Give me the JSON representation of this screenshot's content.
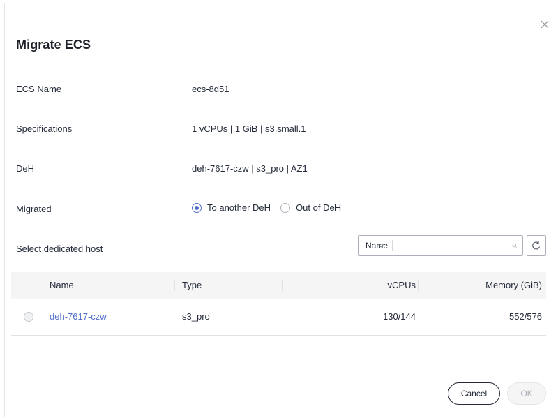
{
  "dialog": {
    "title": "Migrate ECS"
  },
  "fields": {
    "ecs_name": {
      "label": "ECS Name",
      "value": "ecs-8d51"
    },
    "specifications": {
      "label": "Specifications",
      "value": "1 vCPUs | 1 GiB | s3.small.1"
    },
    "deh": {
      "label": "DeH",
      "value": "deh-7617-czw | s3_pro | AZ1"
    },
    "migrated": {
      "label": "Migrated",
      "options": [
        {
          "label": "To another DeH",
          "selected": true
        },
        {
          "label": "Out of DeH",
          "selected": false
        }
      ]
    },
    "select_host": {
      "label": "Select dedicated host"
    }
  },
  "search": {
    "filter_selected": "Name",
    "value": "",
    "placeholder": ""
  },
  "table": {
    "columns": [
      "Name",
      "Type",
      "vCPUs",
      "Memory (GiB)"
    ],
    "rows": [
      {
        "name": "deh-7617-czw",
        "type": "s3_pro",
        "vcpus": "130/144",
        "memory": "552/576",
        "selected": false
      }
    ]
  },
  "footer": {
    "cancel_label": "Cancel",
    "ok_label": "OK"
  },
  "colors": {
    "accent": "#526ecc",
    "text": "#252b3a",
    "border": "#dfe1e6",
    "disabled_text": "#adb0b8"
  }
}
